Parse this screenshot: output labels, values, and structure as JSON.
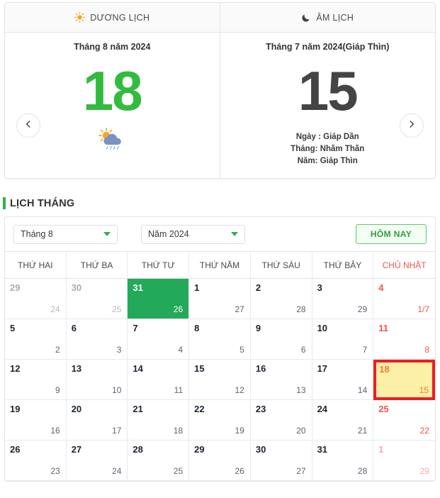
{
  "tabs": [
    {
      "label": "DƯƠNG LỊCH",
      "icon": "sun-icon"
    },
    {
      "label": "ÂM LỊCH",
      "icon": "moon-icon"
    }
  ],
  "solar_panel": {
    "title": "Tháng 8 năm 2024",
    "day": "18",
    "day_color": "#33bb3e",
    "weather_icon": "sun-behind-rain-cloud-icon"
  },
  "lunar_panel": {
    "title": "Tháng 7 năm 2024(Giáp Thìn)",
    "day": "15",
    "day_color": "#444444",
    "detail_day": "Ngày : Giáp Dần",
    "detail_month": "Tháng: Nhâm Thân",
    "detail_year": "Năm: Giáp Thìn"
  },
  "nav": {
    "prev_icon": "chevron-left-icon",
    "next_icon": "chevron-right-icon"
  },
  "section": {
    "title": "LỊCH THÁNG",
    "accent": "#2bb24c"
  },
  "controls": {
    "month_select": "Tháng 8",
    "year_select": "Năm 2024",
    "today_button": "HÔM NAY"
  },
  "weekdays": [
    {
      "label": "THỨ HAI",
      "sunday": false
    },
    {
      "label": "THỨ BA",
      "sunday": false
    },
    {
      "label": "THỨ TƯ",
      "sunday": false
    },
    {
      "label": "THỨ NĂM",
      "sunday": false
    },
    {
      "label": "THỨ SÁU",
      "sunday": false
    },
    {
      "label": "THỨ BẢY",
      "sunday": false
    },
    {
      "label": "CHỦ NHẬT",
      "sunday": true
    }
  ],
  "days": [
    {
      "solar": "29",
      "lunar": "24",
      "state": "out"
    },
    {
      "solar": "30",
      "lunar": "25",
      "state": "out"
    },
    {
      "solar": "31",
      "lunar": "26",
      "state": "green"
    },
    {
      "solar": "1",
      "lunar": "27",
      "state": "normal"
    },
    {
      "solar": "2",
      "lunar": "28",
      "state": "normal"
    },
    {
      "solar": "3",
      "lunar": "29",
      "state": "normal"
    },
    {
      "solar": "4",
      "lunar": "1/7",
      "state": "sunday"
    },
    {
      "solar": "5",
      "lunar": "2",
      "state": "normal"
    },
    {
      "solar": "6",
      "lunar": "3",
      "state": "normal"
    },
    {
      "solar": "7",
      "lunar": "4",
      "state": "normal"
    },
    {
      "solar": "8",
      "lunar": "5",
      "state": "normal"
    },
    {
      "solar": "9",
      "lunar": "6",
      "state": "normal"
    },
    {
      "solar": "10",
      "lunar": "7",
      "state": "normal"
    },
    {
      "solar": "11",
      "lunar": "8",
      "state": "sunday"
    },
    {
      "solar": "12",
      "lunar": "9",
      "state": "normal"
    },
    {
      "solar": "13",
      "lunar": "10",
      "state": "normal"
    },
    {
      "solar": "14",
      "lunar": "11",
      "state": "normal"
    },
    {
      "solar": "15",
      "lunar": "12",
      "state": "normal"
    },
    {
      "solar": "16",
      "lunar": "13",
      "state": "normal"
    },
    {
      "solar": "17",
      "lunar": "14",
      "state": "normal"
    },
    {
      "solar": "18",
      "lunar": "15",
      "state": "selected"
    },
    {
      "solar": "19",
      "lunar": "16",
      "state": "normal"
    },
    {
      "solar": "20",
      "lunar": "17",
      "state": "normal"
    },
    {
      "solar": "21",
      "lunar": "18",
      "state": "normal"
    },
    {
      "solar": "22",
      "lunar": "19",
      "state": "normal"
    },
    {
      "solar": "23",
      "lunar": "20",
      "state": "normal"
    },
    {
      "solar": "24",
      "lunar": "21",
      "state": "normal"
    },
    {
      "solar": "25",
      "lunar": "22",
      "state": "sunday"
    },
    {
      "solar": "26",
      "lunar": "23",
      "state": "normal"
    },
    {
      "solar": "27",
      "lunar": "24",
      "state": "normal"
    },
    {
      "solar": "28",
      "lunar": "25",
      "state": "normal"
    },
    {
      "solar": "29",
      "lunar": "26",
      "state": "normal"
    },
    {
      "solar": "30",
      "lunar": "27",
      "state": "normal"
    },
    {
      "solar": "31",
      "lunar": "28",
      "state": "normal"
    },
    {
      "solar": "1",
      "lunar": "29",
      "state": "out-sunday"
    }
  ]
}
